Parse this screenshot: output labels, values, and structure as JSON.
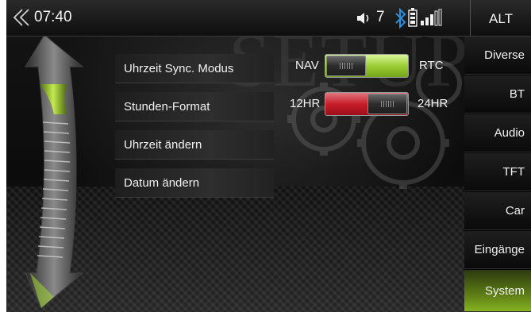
{
  "status_bar": {
    "time": "07:40",
    "volume": "7",
    "mode_button": "ALT"
  },
  "watermark": "SETUP",
  "menu": {
    "items": [
      {
        "label": "Uhrzeit Sync. Modus"
      },
      {
        "label": "Stunden-Format"
      },
      {
        "label": "Uhrzeit ändern"
      },
      {
        "label": "Datum ändern"
      }
    ]
  },
  "toggles": {
    "sync": {
      "left_label": "NAV",
      "right_label": "RTC",
      "selected": "RTC"
    },
    "hour_format": {
      "left_label": "12HR",
      "right_label": "24HR",
      "selected": "12HR"
    }
  },
  "sidebar": {
    "items": [
      {
        "label": "Diverse"
      },
      {
        "label": "BT"
      },
      {
        "label": "Audio"
      },
      {
        "label": "TFT"
      },
      {
        "label": "Car"
      },
      {
        "label": "Eingänge"
      },
      {
        "label": "System",
        "active": true
      }
    ]
  },
  "colors": {
    "accent_green": "#9ccd34",
    "accent_red": "#c81d2a",
    "bluetooth_blue": "#2b8fe0"
  },
  "icons": [
    "back-icon",
    "speaker-icon",
    "bluetooth-icon",
    "battery-icon",
    "signal-icon",
    "scroll-arrow-icon"
  ]
}
